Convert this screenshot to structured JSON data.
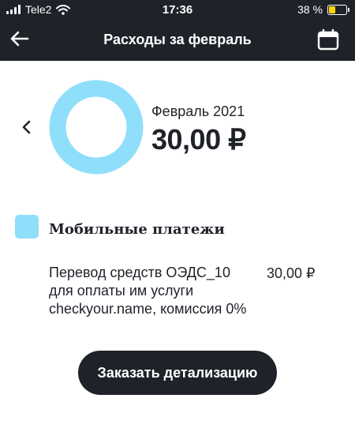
{
  "status_bar": {
    "carrier": "Tele2",
    "time": "17:36",
    "battery_percent": "38 %",
    "battery_level": 0.38
  },
  "header": {
    "title": "Расходы за февраль",
    "back_icon": "arrow-left-icon",
    "calendar_icon": "calendar-icon"
  },
  "summary": {
    "period": "Февраль 2021",
    "total": "30,00 ₽",
    "donut_color": "#8fdffb",
    "prev_icon": "chevron-left-icon"
  },
  "categories": [
    {
      "label": "Мобильные платежи",
      "color": "#8fdffb"
    }
  ],
  "transactions": [
    {
      "description": "Перевод средств ОЭДС_10 для оплаты им услуги checkyour.name, комиссия 0%",
      "amount": "30,00 ₽"
    }
  ],
  "action": {
    "label": "Заказать детализацию"
  },
  "colors": {
    "header_bg": "#1f2229",
    "accent": "#8fdffb",
    "button_bg": "#1f2229"
  }
}
